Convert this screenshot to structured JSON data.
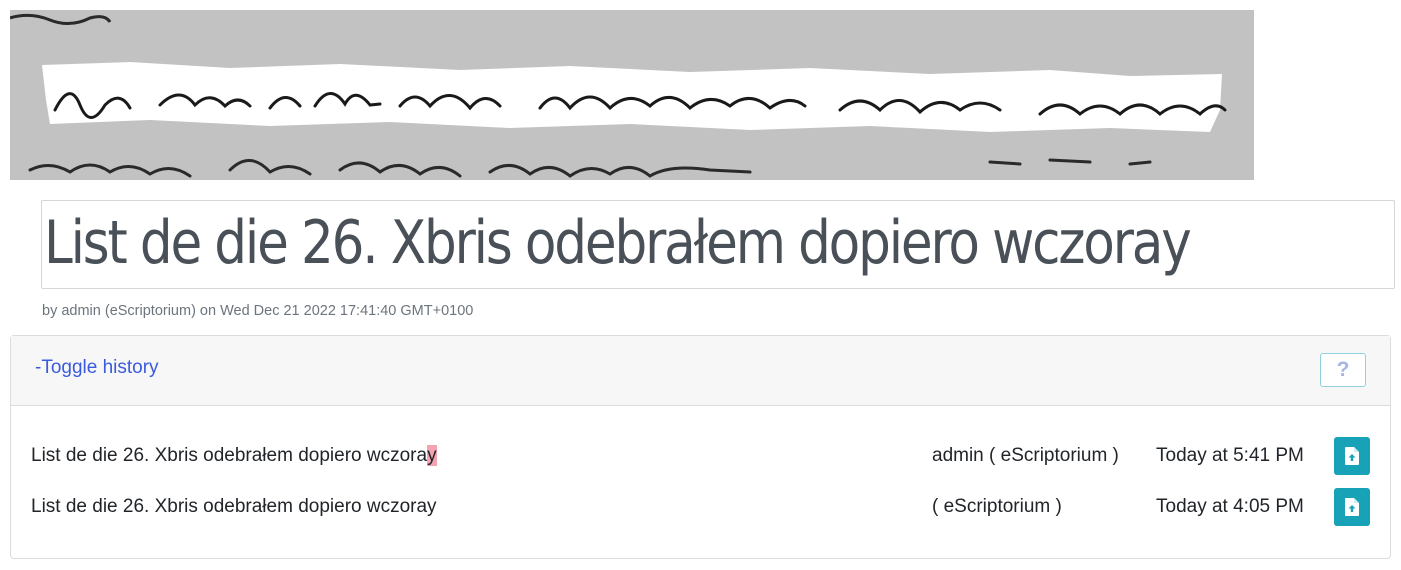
{
  "transcription": {
    "text": "List de die 26. Xbris odebrałem dopiero wczoray",
    "byline": "by admin (eScriptorium) on Wed Dec 21 2022 17:41:40 GMT+0100"
  },
  "history": {
    "toggle_label": "-Toggle history",
    "help_label": "?",
    "rows": [
      {
        "text_main": "List de die 26. Xbris odebrałem dopiero wczora",
        "text_highlight": "y",
        "user": "admin ( eScriptorium )",
        "time": "Today at 5:41 PM",
        "action_icon": "file-upload-icon"
      },
      {
        "text_main": "List de die 26. Xbris odebrałem dopiero wczoray",
        "text_highlight": "",
        "user": "( eScriptorium )",
        "time": "Today at 4:05 PM",
        "action_icon": "file-upload-icon"
      }
    ]
  },
  "colors": {
    "accent": "#17a2b8",
    "link": "#3b5bdb",
    "diff_highlight": "#f3a3b1"
  }
}
